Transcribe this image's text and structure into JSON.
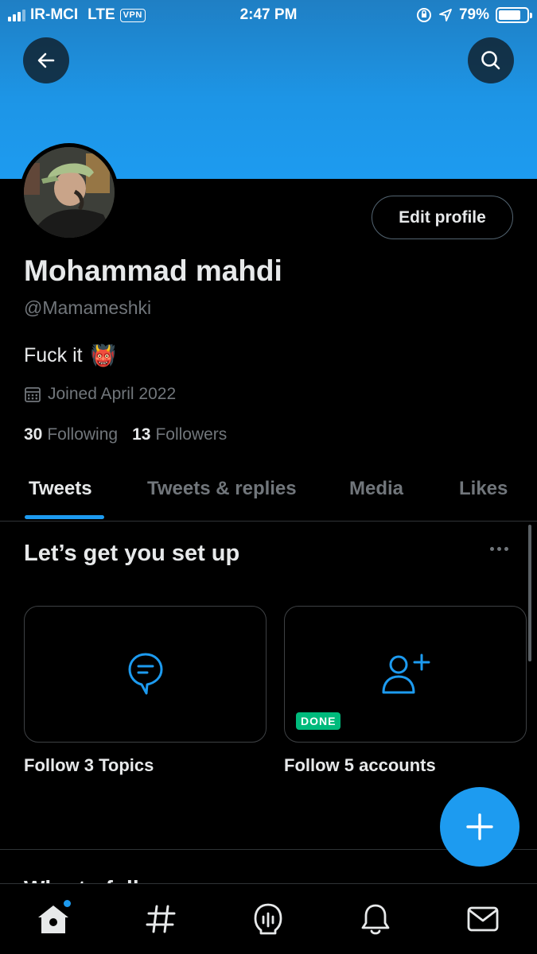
{
  "status_bar": {
    "carrier": "IR-MCI",
    "network": "LTE",
    "vpn_label": "VPN",
    "time": "2:47 PM",
    "battery": "79%",
    "battery_level": 0.79
  },
  "header": {
    "back_icon": "arrow-left-icon",
    "search_icon": "search-icon",
    "banner_color": "#1d9bf0"
  },
  "profile": {
    "edit_label": "Edit profile",
    "name": "Mohammad mahdi",
    "handle": "@Mamameshki",
    "bio": "Fuck it",
    "bio_emoji": "👹",
    "joined": "Joined April 2022",
    "following_count": "30",
    "following_label": "Following",
    "followers_count": "13",
    "followers_label": "Followers"
  },
  "tabs": [
    {
      "label": "Tweets",
      "active": true
    },
    {
      "label": "Tweets & replies",
      "active": false
    },
    {
      "label": "Media",
      "active": false
    },
    {
      "label": "Likes",
      "active": false
    }
  ],
  "setup": {
    "title": "Let’s get you set up",
    "cards": [
      {
        "label": "Follow 3 Topics",
        "icon": "topic-bubble-icon",
        "done": false
      },
      {
        "label": "Follow 5 accounts",
        "icon": "add-user-icon",
        "done": true,
        "badge": "DONE"
      }
    ]
  },
  "next_section_title": "Who to follow",
  "nav": {
    "items": [
      "home-icon",
      "explore-hashtag-icon",
      "spaces-icon",
      "notifications-icon",
      "messages-icon"
    ]
  },
  "colors": {
    "accent": "#1d9bf0",
    "done_green": "#00ba7c",
    "secondary_text": "#71767b"
  }
}
